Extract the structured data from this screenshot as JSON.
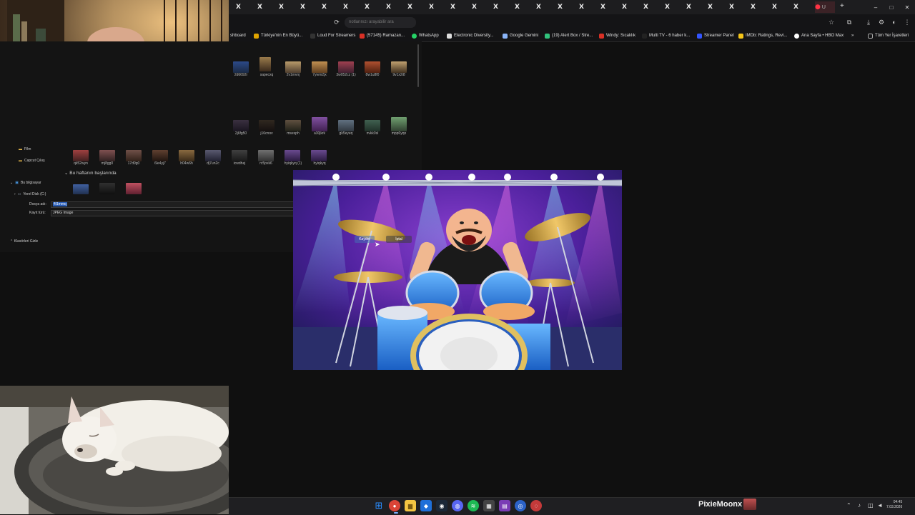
{
  "browser": {
    "tab_label": "X",
    "active_tab_label": "U",
    "new_tab": "+",
    "controls": [
      "–",
      "□",
      "✕"
    ],
    "search_placeholder": "notlarınızı arayabilir ara",
    "toolbar_icons": [
      "star-icon",
      "extensions-icon",
      "download-icon",
      "profile-icon",
      "menu-icon"
    ]
  },
  "bookmarks": [
    {
      "label": "shboard",
      "color": "#555555"
    },
    {
      "label": "Türkiye'nin En Büyü...",
      "color": "#e0a400"
    },
    {
      "label": "Loud For Streamers",
      "color": "#333333"
    },
    {
      "label": "(57145) Ramazan...",
      "color": "#d93025"
    },
    {
      "label": "WhatsApp",
      "color": "#25d366"
    },
    {
      "label": "Electronic Diversity...",
      "color": "#dddddd"
    },
    {
      "label": "Google Gemini",
      "color": "#8ab4f8"
    },
    {
      "label": "(19) Alert Box / Stre...",
      "color": "#31c27c"
    },
    {
      "label": "Windy: Sıcaklık",
      "color": "#d93025"
    },
    {
      "label": "Multi TV - 6 haber k...",
      "color": "#222222"
    },
    {
      "label": "Streamer Panel",
      "color": "#3355ff"
    },
    {
      "label": "IMDb: Ratings, Revi...",
      "color": "#f5c518"
    },
    {
      "label": "Ana Sayfa • HBO Max",
      "color": "#ffffff"
    },
    {
      "label": "»",
      "color": "transparent"
    },
    {
      "label": "Tüm Yer İşaretleri",
      "color": "#aaaaaa"
    }
  ],
  "dialog": {
    "row1_labels": [
      "2d6692r",
      "sapecxq",
      "2v1mvnj",
      "7ywm2jx",
      "3w052cz (1)",
      "8w1u8f0",
      "9v1x2i8"
    ],
    "row2_labels": [
      "2j6fg50",
      "j16cnov",
      "msesph",
      "a30jkrk",
      "gk5eyeq",
      "nvkk0sl",
      "mpp6yqo"
    ],
    "row3_labels": [
      "qk52wyn",
      "mj8gg0",
      "17d9g0",
      "6le4yj7",
      "h04w6h",
      "dj7un2c",
      "icwdhej",
      "rc5pxk6",
      "hyiqkyq (1)",
      "hyiqkyq"
    ],
    "section_title": "Bu haftanın başlarında",
    "sidebar": [
      "Film",
      "Capcut Çıkış",
      "Bu bilgisayar",
      "Yerel Disk (C:)"
    ],
    "filename_label": "Dosya adı:",
    "filename_value": "4i1mmq",
    "filetype_label": "Kayıt türü:",
    "filetype_value": "JPEG Image",
    "hide_folders": "Klasörleri Gizle",
    "save_button": "Kaydet",
    "cancel_button": "İptal"
  },
  "taskbar": {
    "brand": "PixieMoonx",
    "time": "04:45",
    "date": "7.03.2026",
    "apps": [
      {
        "name": "windows-start-icon",
        "color": "#2a8cff",
        "glyph": "⊞"
      },
      {
        "name": "chrome-icon",
        "color": "#db4437",
        "glyph": "●"
      },
      {
        "name": "file-explorer-icon",
        "color": "#f4c542",
        "glyph": "▆"
      },
      {
        "name": "app-blue-icon",
        "color": "#1e6fd9",
        "glyph": "◆"
      },
      {
        "name": "steam-icon",
        "color": "#1b2838",
        "glyph": "◉"
      },
      {
        "name": "discord-icon",
        "color": "#5865f2",
        "glyph": "◍"
      },
      {
        "name": "spotify-icon",
        "color": "#1db954",
        "glyph": "≋"
      },
      {
        "name": "calculator-icon",
        "color": "#444444",
        "glyph": "▦"
      },
      {
        "name": "kick-icon",
        "color": "#7a3cb5",
        "glyph": "▤"
      },
      {
        "name": "obs-icon",
        "color": "#2b62c8",
        "glyph": "◎"
      },
      {
        "name": "app-round-icon",
        "color": "#c43a3a",
        "glyph": "◌"
      }
    ]
  }
}
